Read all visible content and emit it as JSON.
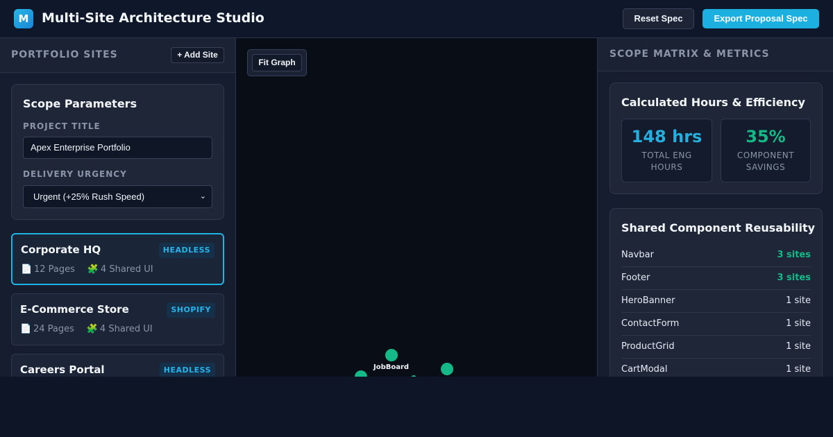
{
  "header": {
    "logo_letter": "M",
    "title": "Multi-Site Architecture Studio",
    "reset_label": "Reset Spec",
    "export_label": "Export Proposal Spec"
  },
  "sidebar": {
    "title": "PORTFOLIO SITES",
    "add_label": "+ Add Site",
    "scope": {
      "title": "Scope Parameters",
      "project_title_label": "PROJECT TITLE",
      "project_title_value": "Apex Enterprise Portfolio",
      "urgency_label": "DELIVERY URGENCY",
      "urgency_value": "Urgent (+25% Rush Speed)"
    },
    "sites": [
      {
        "name": "Corporate HQ",
        "badge": "HEADLESS",
        "pages": "12 Pages",
        "shared": "4 Shared UI",
        "active": true
      },
      {
        "name": "E-Commerce Store",
        "badge": "SHOPIFY",
        "pages": "24 Pages",
        "shared": "4 Shared UI",
        "active": false
      },
      {
        "name": "Careers Portal",
        "badge": "HEADLESS",
        "pages": "",
        "shared": "",
        "active": false
      }
    ]
  },
  "canvas": {
    "fit_label": "Fit Graph",
    "node_labels": [
      "JobBoard"
    ],
    "node_color": "#14b987"
  },
  "metrics": {
    "title": "SCOPE MATRIX & METRICS",
    "hours_card_title": "Calculated Hours & Efficiency",
    "hours_value": "148 hrs",
    "hours_label": "TOTAL ENG HOURS",
    "savings_value": "35%",
    "savings_label": "COMPONENT SAVINGS",
    "reuse_title": "Shared Component Reusability",
    "components": [
      {
        "name": "Navbar",
        "count": "3 sites"
      },
      {
        "name": "Footer",
        "count": "3 sites"
      },
      {
        "name": "HeroBanner",
        "count": "1 site"
      },
      {
        "name": "ContactForm",
        "count": "1 site"
      },
      {
        "name": "ProductGrid",
        "count": "1 site"
      },
      {
        "name": "CartModal",
        "count": "1 site"
      }
    ]
  },
  "colors": {
    "accent": "#1cb0e0",
    "success": "#14b987",
    "background": "#0e1527"
  }
}
